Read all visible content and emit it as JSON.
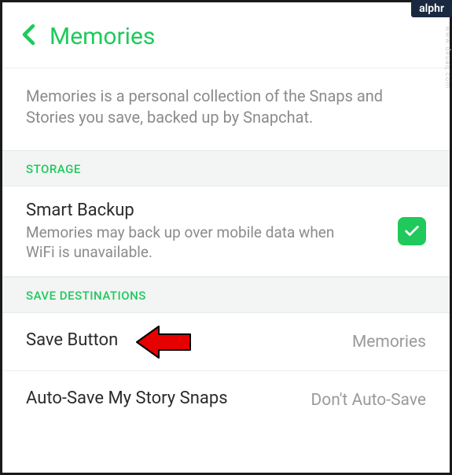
{
  "logo_badge": "alphr",
  "watermark": "www.deuaq.com",
  "header": {
    "title": "Memories"
  },
  "description": "Memories is a personal collection of the Snaps and Stories you save, backed up by Snapchat.",
  "sections": {
    "storage": {
      "label": "STORAGE",
      "smart_backup": {
        "title": "Smart Backup",
        "subtitle": "Memories may back up over mobile data when WiFi is unavailable.",
        "checked": true
      }
    },
    "save_destinations": {
      "label": "SAVE DESTINATIONS",
      "save_button": {
        "title": "Save Button",
        "value": "Memories"
      },
      "auto_save": {
        "title": "Auto-Save My Story Snaps",
        "value": "Don't Auto-Save"
      }
    }
  },
  "colors": {
    "accent": "#1fc95b",
    "text_primary": "#2b2b2b",
    "text_secondary": "#8b8b8b"
  }
}
